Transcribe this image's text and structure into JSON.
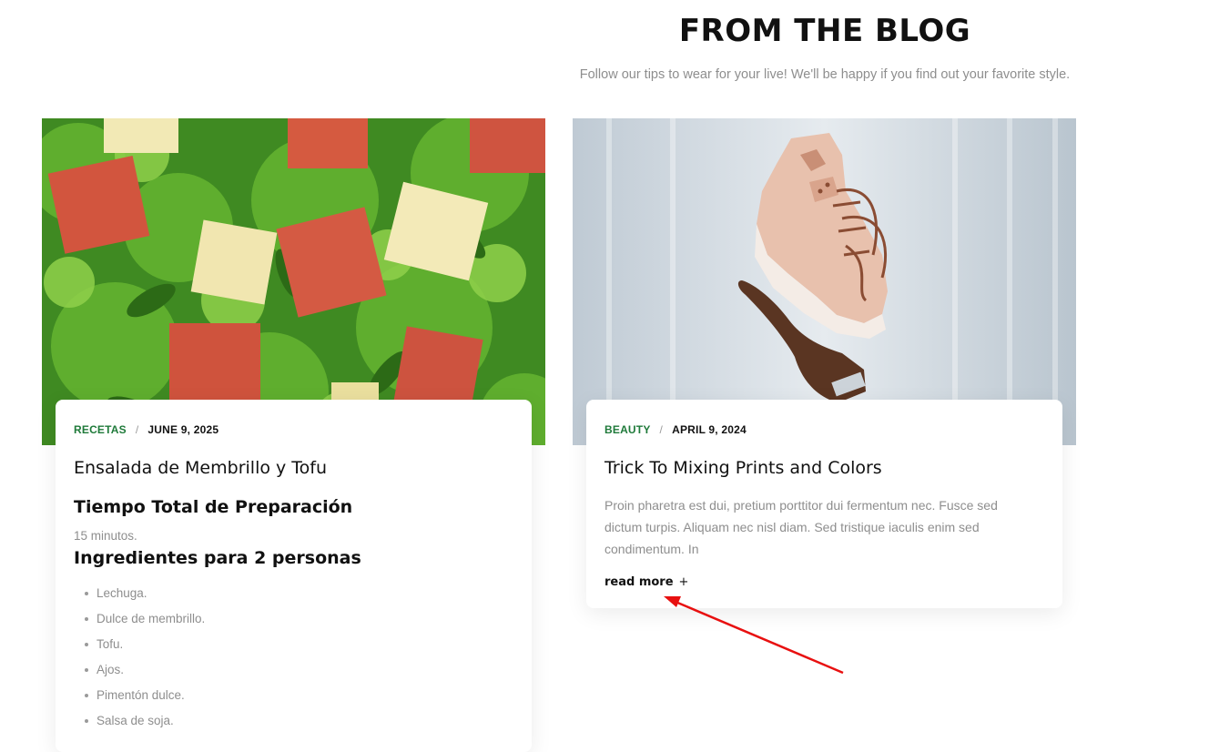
{
  "section": {
    "title": "FROM THE BLOG",
    "subtitle": "Follow our tips to wear for your live! We'll be happy if you find out your favorite style."
  },
  "posts": [
    {
      "category": "RECETAS",
      "date": "JUNE 9, 2025",
      "title": "Ensalada de Membrillo y Tofu",
      "image_icon": "salad-image",
      "body": {
        "heading_1": "Tiempo Total de Preparación",
        "prep_time": "15 minutos.",
        "heading_2": "Ingredientes para 2 personas",
        "ingredients": [
          "Lechuga.",
          "Dulce de membrillo.",
          "Tofu.",
          "Ajos.",
          "Pimentón dulce.",
          "Salsa de soja."
        ]
      }
    },
    {
      "category": "BEAUTY",
      "date": "APRIL 9, 2024",
      "title": "Trick To Mixing Prints and Colors",
      "image_icon": "sneaker-image",
      "excerpt": "Proin pharetra est dui, pretium porttitor dui fermentum nec. Fusce sed dictum turpis. Aliquam nec nisl diam. Sed tristique iaculis enim sed condimentum. In",
      "read_more": "read more",
      "read_more_icon": "+"
    }
  ],
  "annotation": {
    "arrow_color": "#e81010"
  },
  "colors": {
    "category": "#1f7a3a",
    "muted_text": "#8e8e8e",
    "heading": "#111111"
  }
}
